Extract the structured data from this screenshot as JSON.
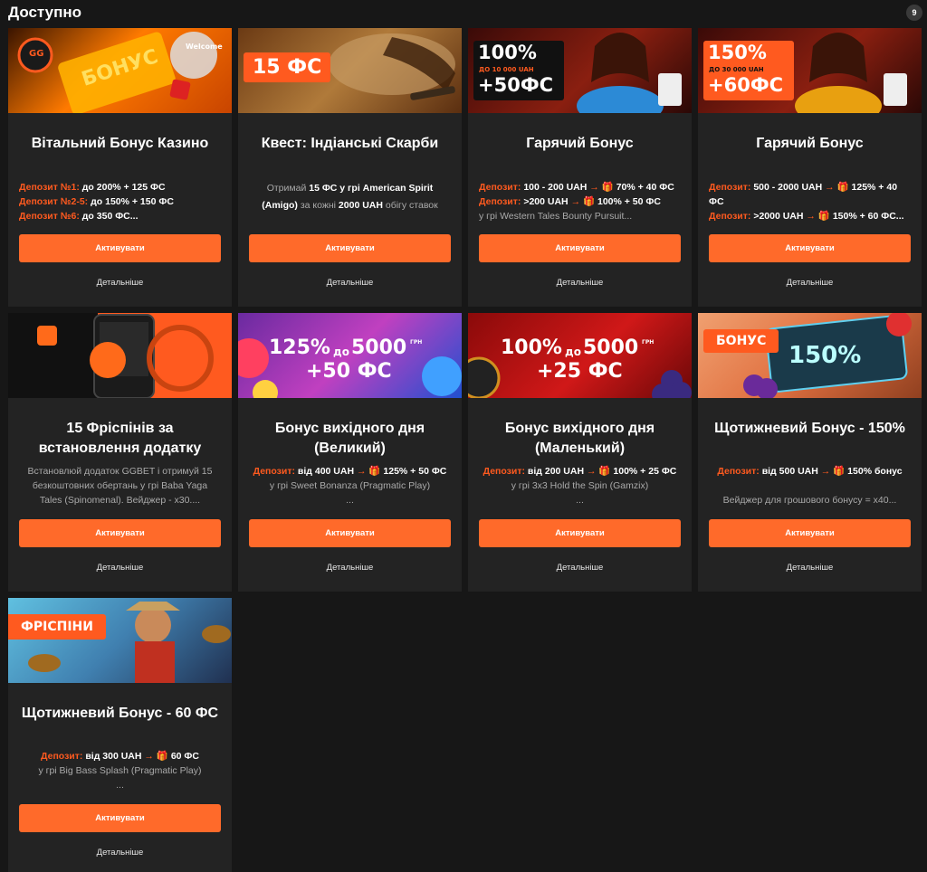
{
  "header": {
    "title": "Доступно",
    "count": "9"
  },
  "common": {
    "activate": "Активувати",
    "details": "Детальніше"
  },
  "cards": [
    {
      "title": "Вітальний Бонус Казино",
      "banner": {
        "tag": "Welcome",
        "word": "БОНУС",
        "chip": "GG"
      },
      "lines": [
        {
          "label": "Депозит №1:",
          "text": "до 200% + 125 ФС"
        },
        {
          "label": "Депозит №2-5:",
          "text": "до 150% + 150 ФС"
        },
        {
          "label": "Депозит №6:",
          "text": "до 350 ФС..."
        }
      ]
    },
    {
      "title": "Квест: Індіанські Скарби",
      "banner": {
        "badge": "15 ФС"
      },
      "desc": {
        "p1": "Отримай ",
        "b1": "15 ФС у грі American Spirit",
        "b2": "(Amigo)",
        "p2": " за кожні ",
        "b3": "2000 UAH",
        "p3": " обігу ставок"
      }
    },
    {
      "title": "Гарячий Бонус",
      "banner": {
        "big": "100%",
        "small": "ДО 10 000 UAH",
        "extra": "+50ФС"
      },
      "lines": [
        {
          "label": "Депозит:",
          "text": "100 - 200 UAH",
          "arrow": "→",
          "gift": "🎁",
          "reward": "70% + 40 ФС"
        },
        {
          "label": "Депозит:",
          "text": ">200 UAH",
          "arrow": "→",
          "gift": "🎁",
          "reward": "100% + 50 ФС"
        }
      ],
      "note": "у грі Western Tales Bounty Pursuit..."
    },
    {
      "title": "Гарячий Бонус",
      "banner": {
        "big": "150%",
        "small": "ДО 30 000 UAH",
        "extra": "+60ФС"
      },
      "line1": {
        "label": "Депозит:",
        "text": "500 - 2000 UAH",
        "arrow": "→",
        "gift": "🎁",
        "reward": "125% + 40",
        "cont": "ФС"
      },
      "line2": {
        "label": "Депозит:",
        "text": ">2000 UAH",
        "arrow": "→",
        "gift": "🎁",
        "reward": "150% + 60 ФС..."
      }
    },
    {
      "title_l1": "15 Фріспінів за",
      "title_l2": "встановлення додатку",
      "desc_lines": [
        "Встановлюй додаток GGBET і отримуй 15",
        "безкоштовних обертань у грі Baba Yaga",
        "Tales (Spinomenal). Вейджер - x30...."
      ]
    },
    {
      "title_l1": "Бонус вихідного дня",
      "title_l2": "(Великий)",
      "banner": {
        "big": "125%",
        "mid": "до",
        "amount": "5000",
        "cur": "ГРН",
        "extra": "+50 ФС"
      },
      "line": {
        "label": "Депозит:",
        "text": "від 400 UAH",
        "arrow": "→",
        "gift": "🎁",
        "reward": "125% + 50 ФС"
      },
      "note": "у грі Sweet Bonanza (Pragmatic Play)",
      "dots": "..."
    },
    {
      "title_l1": "Бонус вихідного дня",
      "title_l2": "(Маленький)",
      "banner": {
        "big": "100%",
        "mid": "до",
        "amount": "5000",
        "cur": "ГРН",
        "extra": "+25 ФС"
      },
      "line": {
        "label": "Депозит:",
        "text": "від 200 UAH",
        "arrow": "→",
        "gift": "🎁",
        "reward": "100% + 25 ФС"
      },
      "note": "у грі 3x3 Hold the Spin (Gamzix)",
      "dots": "..."
    },
    {
      "title": "Щотижневий Бонус - 150%",
      "banner": {
        "badge": "БОНУС",
        "big": "150%"
      },
      "line": {
        "label": "Депозит:",
        "text": "від 500 UAH",
        "arrow": "→",
        "gift": "🎁",
        "reward": "150% бонус"
      },
      "note": "Вейджер для грошового бонусу = x40..."
    },
    {
      "title": "Щотижневий Бонус - 60 ФС",
      "banner": {
        "badge": "ФРІСПІНИ"
      },
      "line": {
        "label": "Депозит:",
        "text": "від 300 UAH",
        "arrow": "→",
        "gift": "🎁",
        "reward": "60 ФС"
      },
      "note": "у грі Big Bass Splash (Pragmatic Play)",
      "dots": "..."
    }
  ],
  "colors": {
    "accent": "#ff6a2a",
    "card": "#232323",
    "bg": "#171717"
  }
}
